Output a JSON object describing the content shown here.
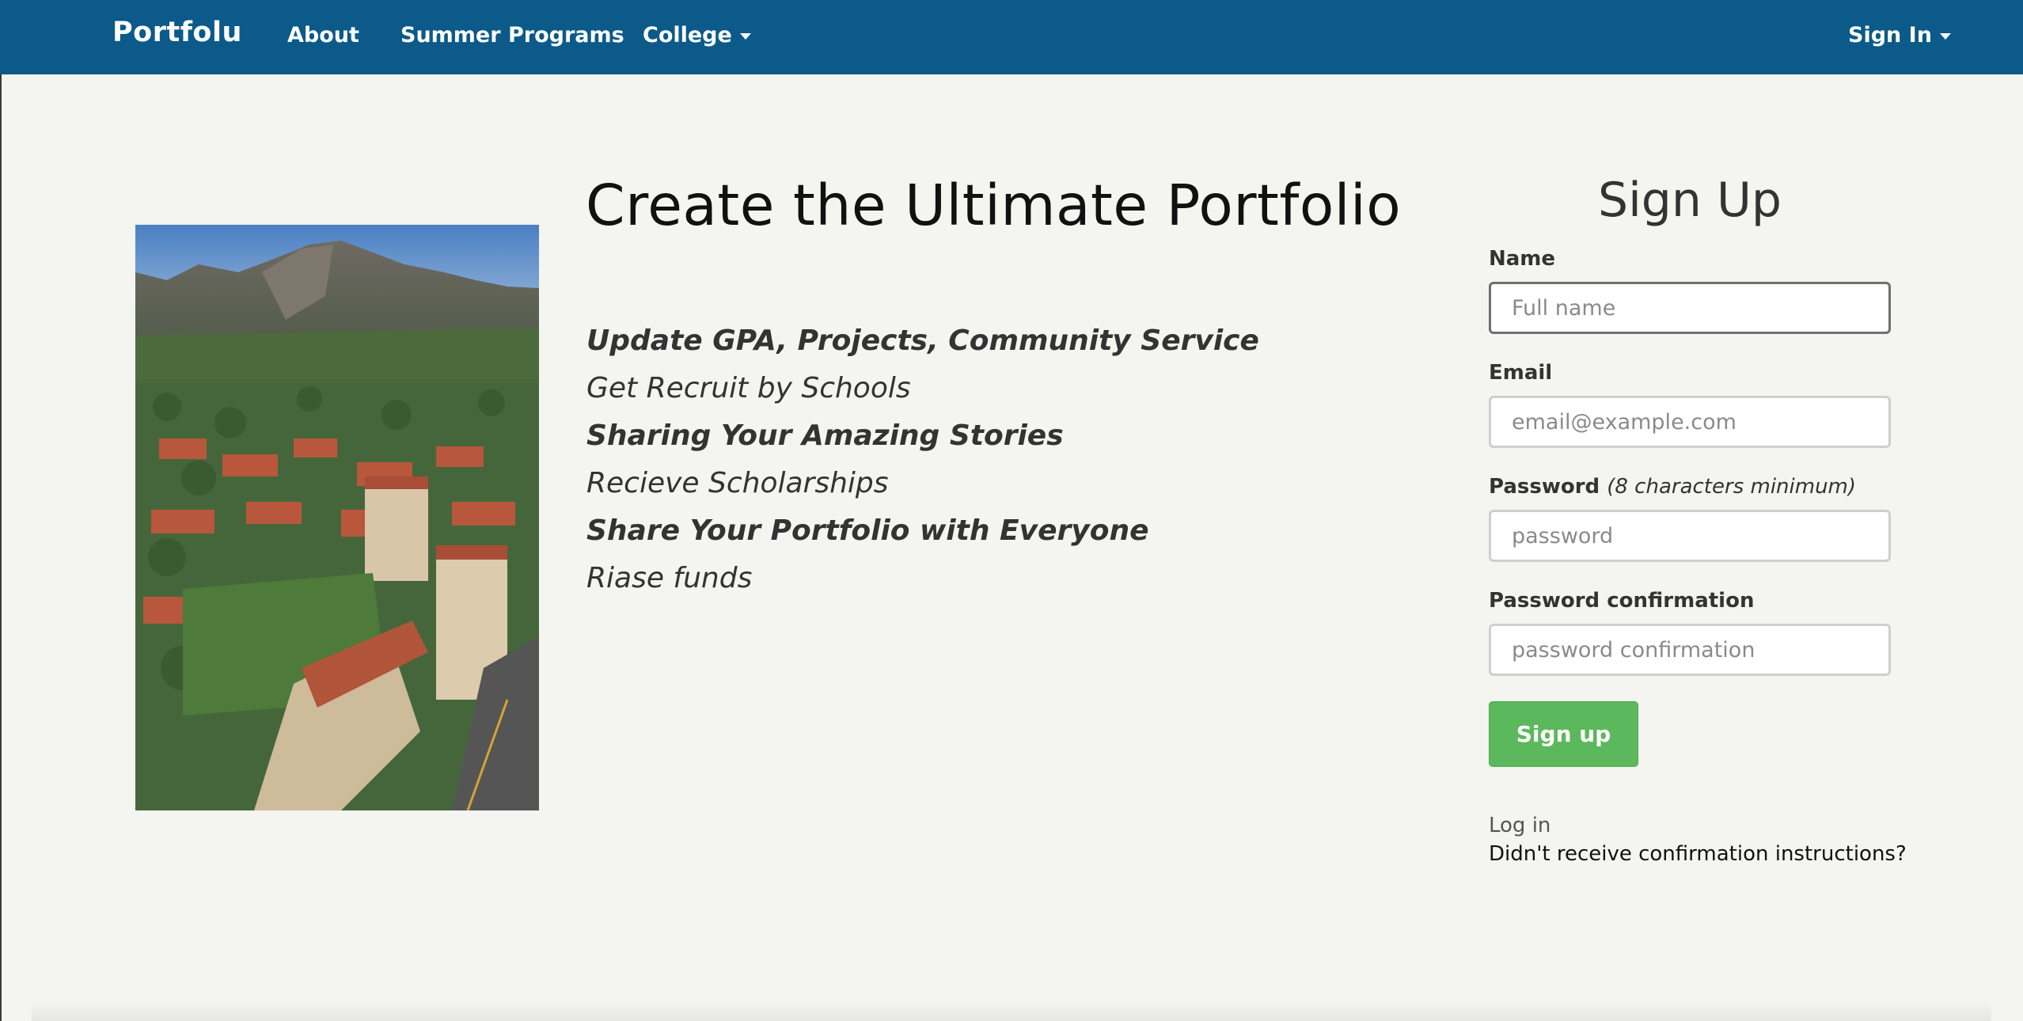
{
  "navbar": {
    "brand": "Portfolu",
    "links": [
      {
        "label": "About"
      },
      {
        "label": "Summer Programs"
      },
      {
        "label": "College"
      }
    ],
    "sign_in": "Sign In",
    "background": "#0b5a89"
  },
  "hero": {
    "image_description_icon": "campus-photo",
    "headline": "Create the Ultimate Portfolio",
    "features": [
      {
        "text": "Update GPA, Projects, Community Service",
        "bold": true
      },
      {
        "text": "Get Recruit by Schools",
        "bold": false
      },
      {
        "text": "Sharing Your Amazing Stories",
        "bold": true
      },
      {
        "text": "Recieve Scholarships",
        "bold": false
      },
      {
        "text": "Share Your Portfolio with Everyone",
        "bold": true
      },
      {
        "text": "Riase funds",
        "bold": false
      }
    ]
  },
  "signup": {
    "title": "Sign Up",
    "name_label": "Name",
    "name_placeholder": "Full name",
    "email_label": "Email",
    "email_placeholder": "email@example.com",
    "password_label": "Password",
    "password_hint": "(8 characters minimum)",
    "password_placeholder": "password",
    "confirmation_label": "Password confirmation",
    "confirmation_placeholder": "password confirmation",
    "submit_label": "Sign up",
    "submit_color": "#5cb85c",
    "login_link": "Log in",
    "confirm_link": "Didn't receive confirmation instructions?"
  }
}
